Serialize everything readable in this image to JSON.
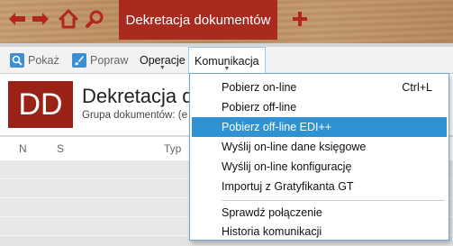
{
  "topbar": {
    "active_tab": "Dekretacja dokumentów",
    "icons": [
      "arrow-left-icon",
      "arrow-right-icon",
      "home-icon",
      "search-icon",
      "plus-icon"
    ],
    "accent": "#a92a1f"
  },
  "toolbar": {
    "show_label": "Pokaż",
    "fix_label": "Popraw",
    "operations_label": "Operacje",
    "communication_label": "Komunikacja"
  },
  "header": {
    "logo": "DD",
    "title": "Dekretacja d",
    "subtitle": "Grupa dokumentów: (e"
  },
  "grid": {
    "columns": [
      "N",
      "S",
      "Typ"
    ]
  },
  "menu": {
    "items": [
      {
        "label": "Pobierz on-line",
        "shortcut": "Ctrl+L"
      },
      {
        "label": "Pobierz off-line",
        "shortcut": ""
      },
      {
        "label": "Pobierz off-line EDI++",
        "shortcut": ""
      },
      {
        "label": "Wyślij on-line dane księgowe",
        "shortcut": ""
      },
      {
        "label": "Wyślij on-line konfigurację",
        "shortcut": ""
      },
      {
        "label": "Importuj z Gratyfikanta GT",
        "shortcut": ""
      },
      {
        "label": "Sprawdź połączenie",
        "shortcut": ""
      },
      {
        "label": "Historia komunikacji",
        "shortcut": ""
      }
    ],
    "highlight_color": "#2f93d3"
  }
}
